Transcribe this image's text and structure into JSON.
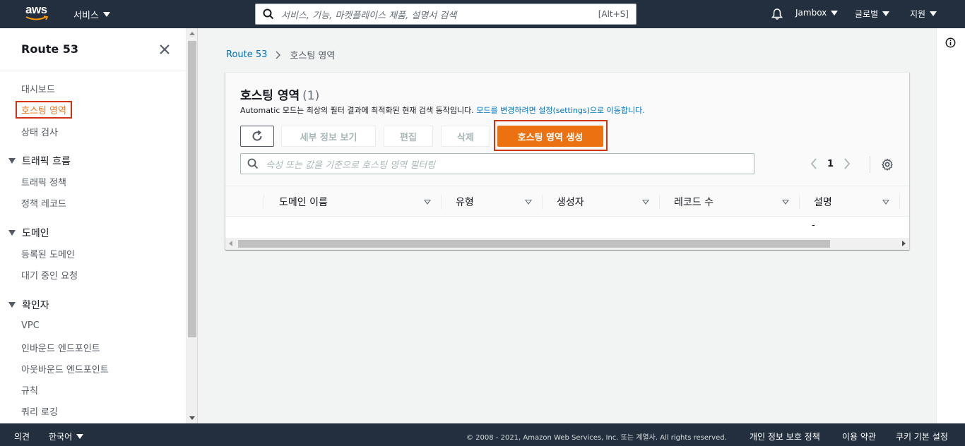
{
  "topnav": {
    "logo_text": "aws",
    "services_label": "서비스",
    "search_placeholder": "서비스, 기능, 마켓플레이스 제품, 설명서 검색",
    "search_shortcut": "[Alt+S]",
    "account_label": "Jambox",
    "region_label": "글로벌",
    "support_label": "지원"
  },
  "sidebar": {
    "title": "Route 53",
    "items": {
      "dashboard": "대시보드",
      "hosted_zones": "호스팅 영역",
      "health_checks": "상태 검사",
      "traffic_flow": "트래픽 흐름",
      "traffic_policies": "트래픽 정책",
      "policy_records": "정책 레코드",
      "domains": "도메인",
      "registered_domains": "등록된 도메인",
      "pending_requests": "대기 중인 요청",
      "resolver": "확인자",
      "vpc": "VPC",
      "inbound_endpoints": "인바운드 엔드포인트",
      "outbound_endpoints": "아웃바운드 엔드포인트",
      "rules": "규칙",
      "query_logging": "쿼리 로깅"
    }
  },
  "breadcrumb": {
    "root": "Route 53",
    "current": "호스팅 영역"
  },
  "panel": {
    "title": "호스팅 영역",
    "count": "(1)",
    "desc_prefix": "Automatic 모드는 최상의 필터 결과에 최적화된 현재 검색 동작입니다.",
    "desc_link": "모드를 변경하려면 설정(settings)으로 이동합니다.",
    "buttons": {
      "view_details": "세부 정보 보기",
      "edit": "편집",
      "delete": "삭제",
      "create": "호스팅 영역 생성"
    },
    "filter_placeholder": "속성 또는 값을 기준으로 호스팅 영역 필터링",
    "page": "1"
  },
  "table": {
    "columns": [
      "도메인 이름",
      "유형",
      "생성자",
      "레코드 수",
      "설명"
    ],
    "rows": [
      [
        "",
        "",
        "",
        "",
        "-"
      ]
    ]
  },
  "footer": {
    "feedback": "의견",
    "language": "한국어",
    "copyright": "© 2008 - 2021, Amazon Web Services, Inc. 또는 계열사. All rights reserved.",
    "privacy": "개인 정보 보호 정책",
    "terms": "이용 약관",
    "cookies": "쿠키 기본 설정"
  },
  "colors": {
    "nav_bg": "#232f3e",
    "accent": "#ec7211",
    "link": "#0073bb",
    "highlight": "#d13212"
  }
}
